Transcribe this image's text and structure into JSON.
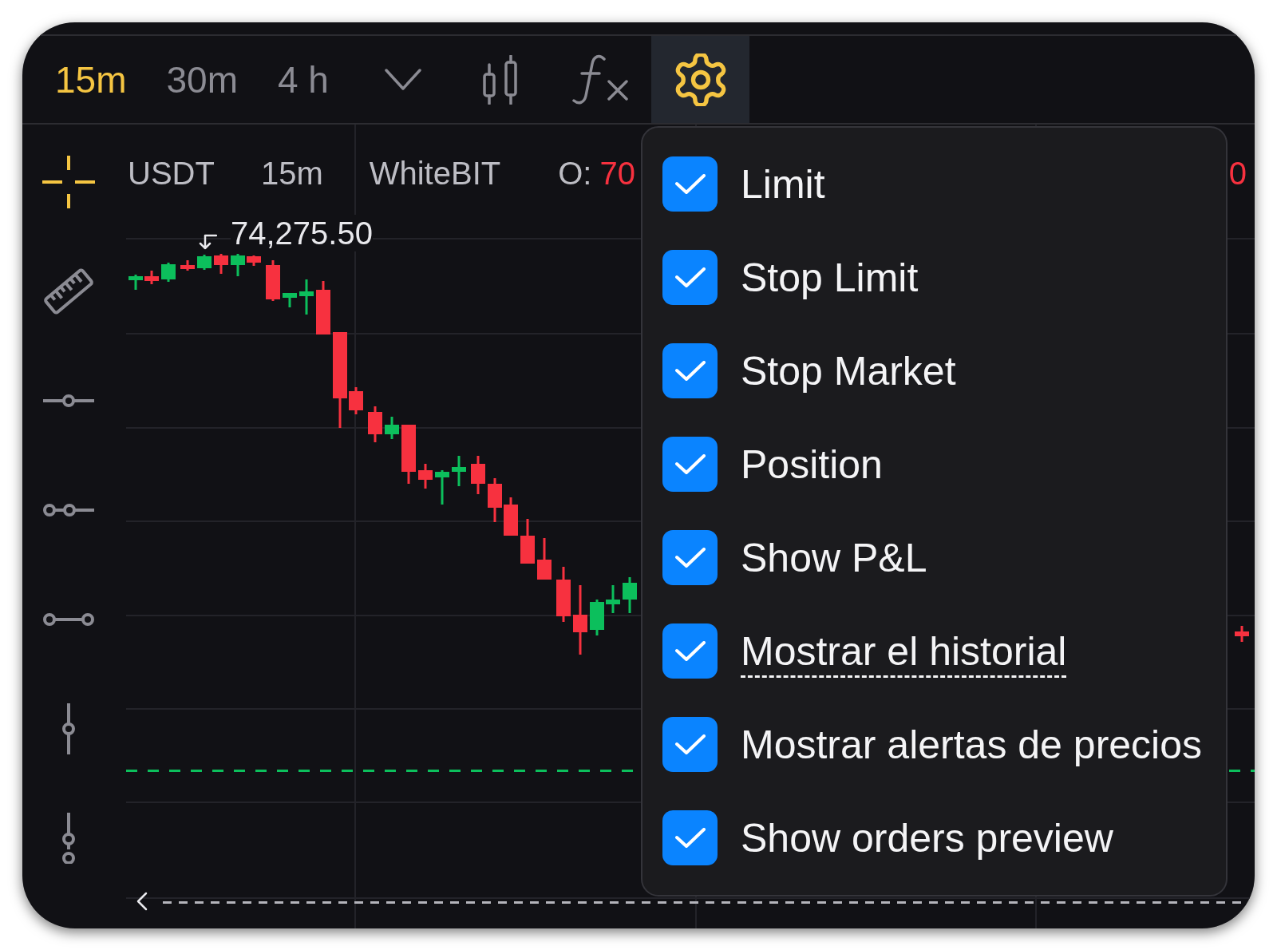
{
  "toolbar": {
    "timeframes": [
      {
        "label": "15m",
        "selected": true
      },
      {
        "label": "30m",
        "selected": false
      },
      {
        "label": "4 h",
        "selected": false
      }
    ],
    "settings": {
      "active": true
    }
  },
  "chart": {
    "legend": {
      "symbol": "USDT",
      "interval": "15m",
      "exchange": "WhiteBIT",
      "open_label": "O:",
      "open_value": "70",
      "cut_value": "0"
    },
    "high_price_label": "74,275.50"
  },
  "settings_menu": {
    "items": [
      {
        "label": "Limit",
        "checked": true,
        "underlined": false
      },
      {
        "label": "Stop Limit",
        "checked": true,
        "underlined": false
      },
      {
        "label": "Stop Market",
        "checked": true,
        "underlined": false
      },
      {
        "label": "Position",
        "checked": true,
        "underlined": false
      },
      {
        "label": "Show P&L",
        "checked": true,
        "underlined": false
      },
      {
        "label": "Mostrar el historial",
        "checked": true,
        "underlined": true
      },
      {
        "label": "Mostrar alertas de precios",
        "checked": true,
        "underlined": false
      },
      {
        "label": "Show orders preview",
        "checked": true,
        "underlined": false
      }
    ]
  }
}
